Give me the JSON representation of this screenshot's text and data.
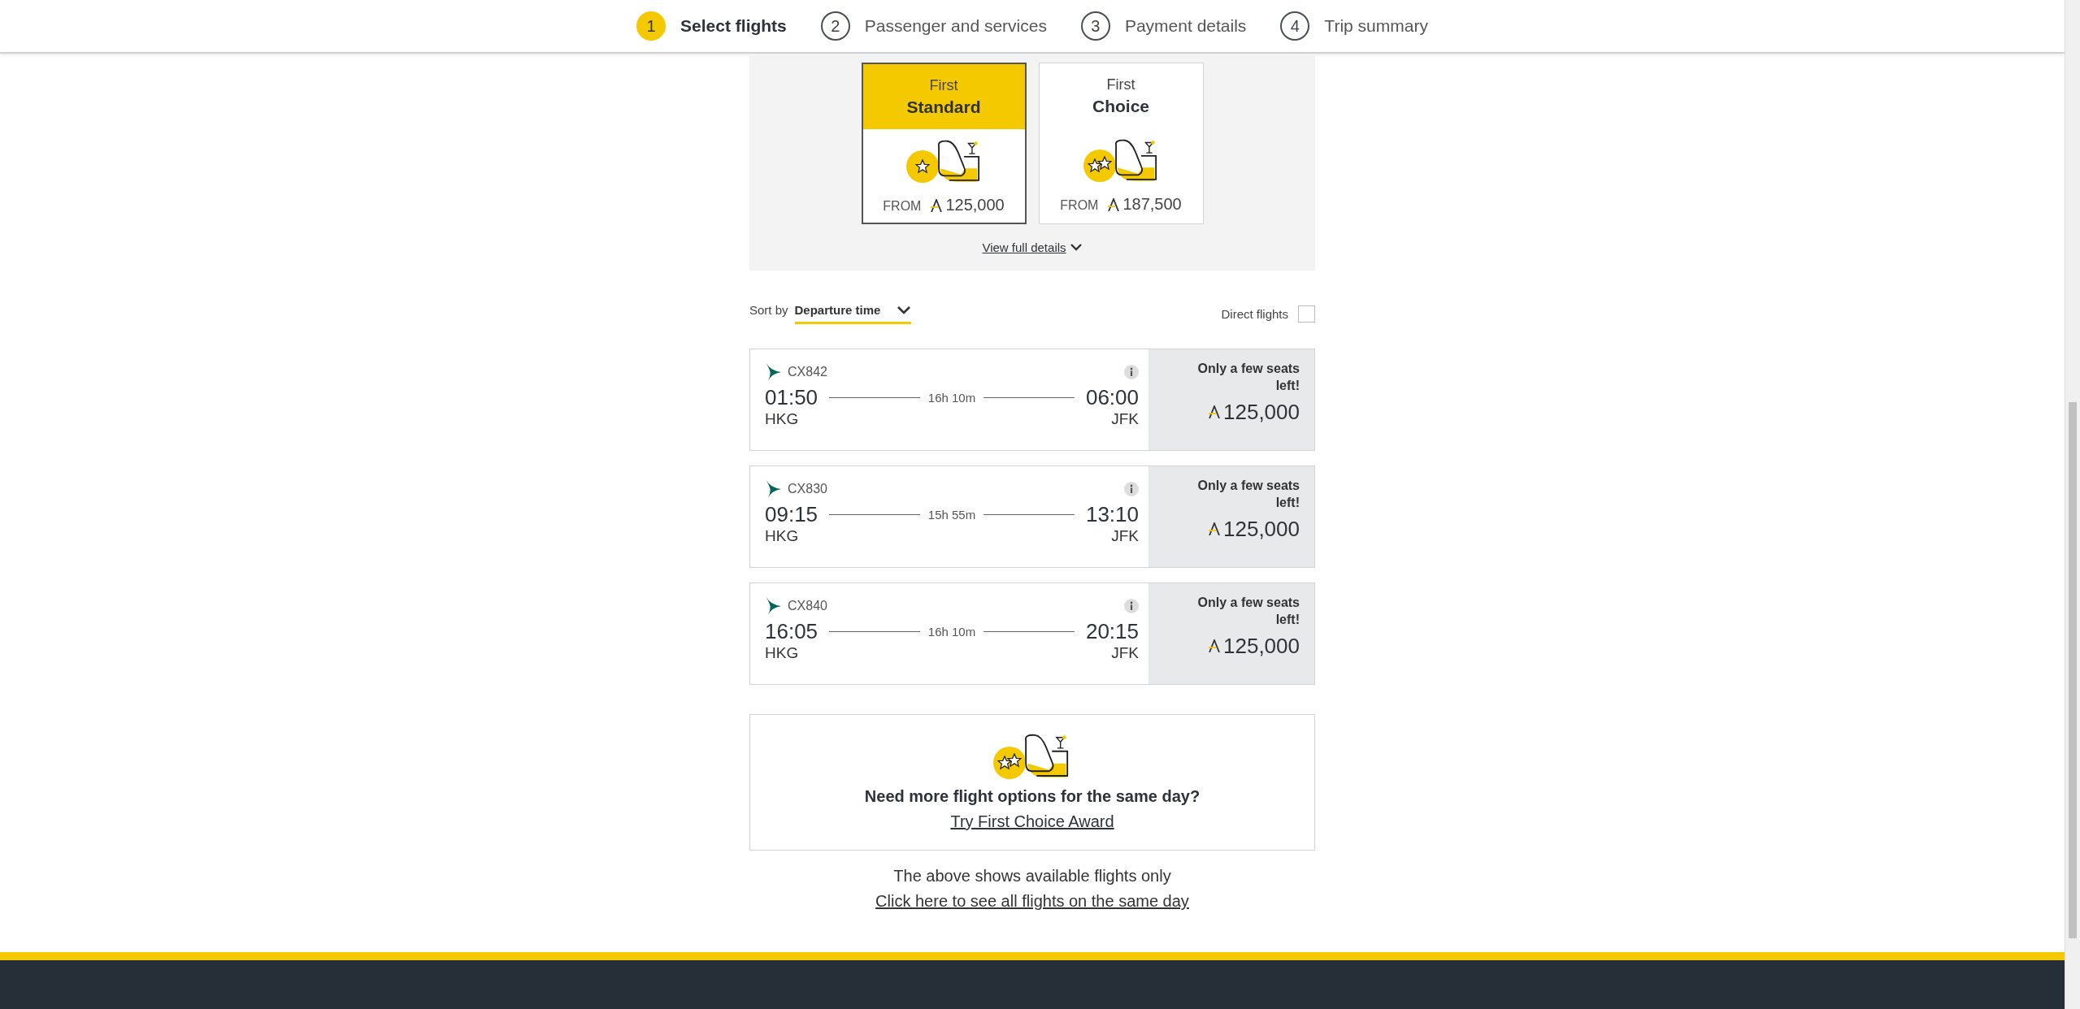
{
  "steps": [
    {
      "number": "1",
      "label": "Select flights",
      "selected": true
    },
    {
      "number": "2",
      "label": "Passenger and services",
      "selected": false
    },
    {
      "number": "3",
      "label": "Payment details",
      "selected": false
    },
    {
      "number": "4",
      "label": "Trip summary",
      "selected": false
    }
  ],
  "fare_types": [
    {
      "cabin": "First",
      "name": "Standard",
      "kind": "standard",
      "from_label": "FROM",
      "price": "125,000",
      "selected": true
    },
    {
      "cabin": "First",
      "name": "Choice",
      "kind": "choice",
      "from_label": "FROM",
      "price": "187,500",
      "selected": false
    }
  ],
  "view_details": "View full details",
  "sort": {
    "label": "Sort by",
    "value": "Departure time"
  },
  "direct_flights": {
    "label": "Direct flights",
    "checked": false
  },
  "flights": [
    {
      "flight_number": "CX842",
      "depart_time": "01:50",
      "depart_airport": "HKG",
      "duration": "16h 10m",
      "arrive_time": "06:00",
      "arrive_airport": "JFK",
      "availability": "Only a few seats left!",
      "price": "125,000"
    },
    {
      "flight_number": "CX830",
      "depart_time": "09:15",
      "depart_airport": "HKG",
      "duration": "15h 55m",
      "arrive_time": "13:10",
      "arrive_airport": "JFK",
      "availability": "Only a few seats left!",
      "price": "125,000"
    },
    {
      "flight_number": "CX840",
      "depart_time": "16:05",
      "depart_airport": "HKG",
      "duration": "16h 10m",
      "arrive_time": "20:15",
      "arrive_airport": "JFK",
      "availability": "Only a few seats left!",
      "price": "125,000"
    }
  ],
  "promo": {
    "kind": "choice",
    "heading": "Need more flight options for the same day?",
    "link": "Try First Choice Award"
  },
  "note": "The above shows available flights only",
  "all_flights_link": "Click here to see all flights on the same day"
}
